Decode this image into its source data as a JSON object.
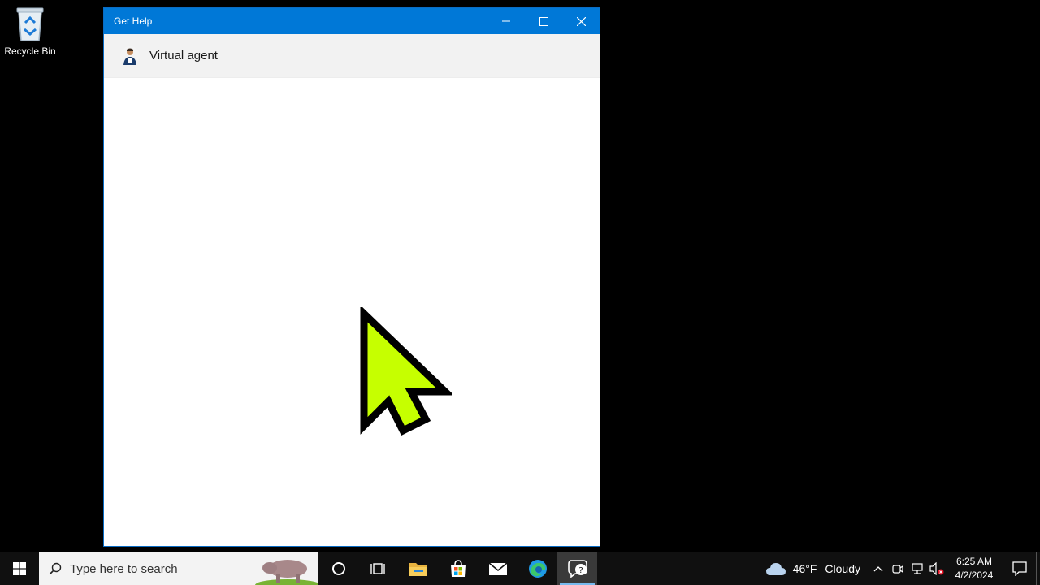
{
  "desktop": {
    "icons": [
      {
        "label": "Recycle Bin",
        "icon": "recycle-bin-icon"
      }
    ]
  },
  "window": {
    "title": "Get Help",
    "controls": {
      "minimize": "minimize-icon",
      "maximize": "maximize-icon",
      "close": "close-icon"
    },
    "header": {
      "agent_name": "Virtual agent",
      "avatar": "agent-avatar-icon"
    }
  },
  "taskbar": {
    "search_placeholder": "Type here to search",
    "apps": [
      "cortana-icon",
      "task-view-icon",
      "file-explorer-icon",
      "microsoft-store-icon",
      "mail-icon",
      "edge-icon",
      "get-help-icon"
    ],
    "active_app": "get-help-icon",
    "weather": {
      "temperature": "46°F",
      "condition": "Cloudy",
      "icon": "cloud-icon"
    },
    "clock": {
      "time": "6:25 AM",
      "date": "4/2/2024"
    }
  },
  "colors": {
    "titlebar": "#0078d7",
    "taskbar": "#101010",
    "cursor": "#c6ff00"
  }
}
